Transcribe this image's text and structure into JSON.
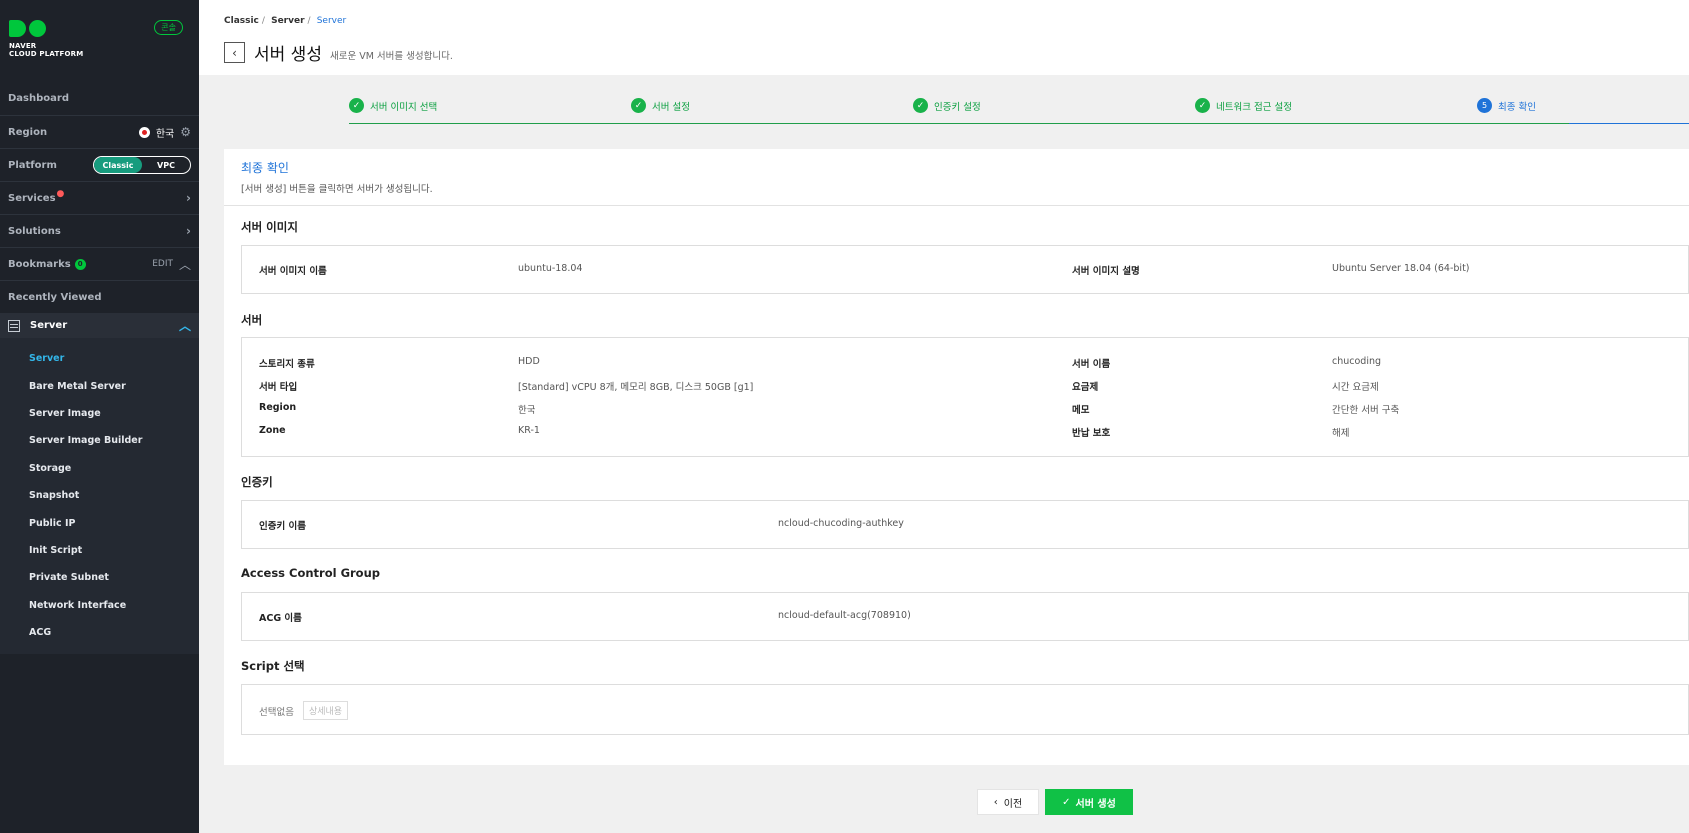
{
  "sidebar": {
    "logo_line1": "NAVER",
    "logo_line2": "CLOUD PLATFORM",
    "console_label": "콘솔",
    "dashboard": "Dashboard",
    "region_label": "Region",
    "region_value": "한국",
    "platform_label": "Platform",
    "platform_options": [
      "Classic",
      "VPC"
    ],
    "platform_selected": "Classic",
    "services": "Services",
    "solutions": "Solutions",
    "bookmarks": "Bookmarks",
    "bookmarks_count": "0",
    "edit": "EDIT",
    "recently_viewed": "Recently Viewed",
    "server_group": "Server",
    "items": [
      {
        "label": "Server",
        "active": true
      },
      {
        "label": "Bare Metal Server"
      },
      {
        "label": "Server Image"
      },
      {
        "label": "Server Image Builder"
      },
      {
        "label": "Storage"
      },
      {
        "label": "Snapshot"
      },
      {
        "label": "Public IP"
      },
      {
        "label": "Init Script"
      },
      {
        "label": "Private Subnet"
      },
      {
        "label": "Network Interface"
      },
      {
        "label": "ACG"
      }
    ]
  },
  "header": {
    "breadcrumb": [
      "Classic",
      "Server",
      "Server"
    ],
    "title": "서버 생성",
    "subtitle": "새로운 VM 서버를 생성합니다."
  },
  "steps": [
    {
      "label": "서버 이미지 선택",
      "done": true
    },
    {
      "label": "서버 설정",
      "done": true
    },
    {
      "label": "인증키 설정",
      "done": true
    },
    {
      "label": "네트워크 접근 설정",
      "done": true
    },
    {
      "label": "최종 확인",
      "number": "5",
      "current": true
    }
  ],
  "panel": {
    "title": "최종 확인",
    "description": "[서버 생성] 버튼을 클릭하면 서버가 생성됩니다."
  },
  "sections": {
    "image": {
      "title": "서버 이미지",
      "name_label": "서버 이미지 이름",
      "name_value": "ubuntu-18.04",
      "desc_label": "서버 이미지 설명",
      "desc_value": "Ubuntu Server 18.04 (64-bit)"
    },
    "server": {
      "title": "서버",
      "left": [
        {
          "label": "스토리지 종류",
          "value": "HDD"
        },
        {
          "label": "서버 타입",
          "value": "[Standard] vCPU 8개, 메모리 8GB, 디스크 50GB [g1]"
        },
        {
          "label": "Region",
          "value": "한국"
        },
        {
          "label": "Zone",
          "value": "KR-1"
        }
      ],
      "right": [
        {
          "label": "서버 이름",
          "value": "chucoding"
        },
        {
          "label": "요금제",
          "value": "시간 요금제"
        },
        {
          "label": "메모",
          "value": "간단한 서버 구축"
        },
        {
          "label": "반납 보호",
          "value": "해제"
        }
      ]
    },
    "authkey": {
      "title": "인증키",
      "label": "인증키 이름",
      "value": "ncloud-chucoding-authkey"
    },
    "acg": {
      "title": "Access Control Group",
      "label": "ACG 이름",
      "value": "ncloud-default-acg(708910)"
    },
    "script": {
      "title": "Script 선택",
      "value": "선택없음",
      "detail_button": "상세내용"
    }
  },
  "footer": {
    "prev_label": "이전",
    "create_label": "서버 생성"
  }
}
